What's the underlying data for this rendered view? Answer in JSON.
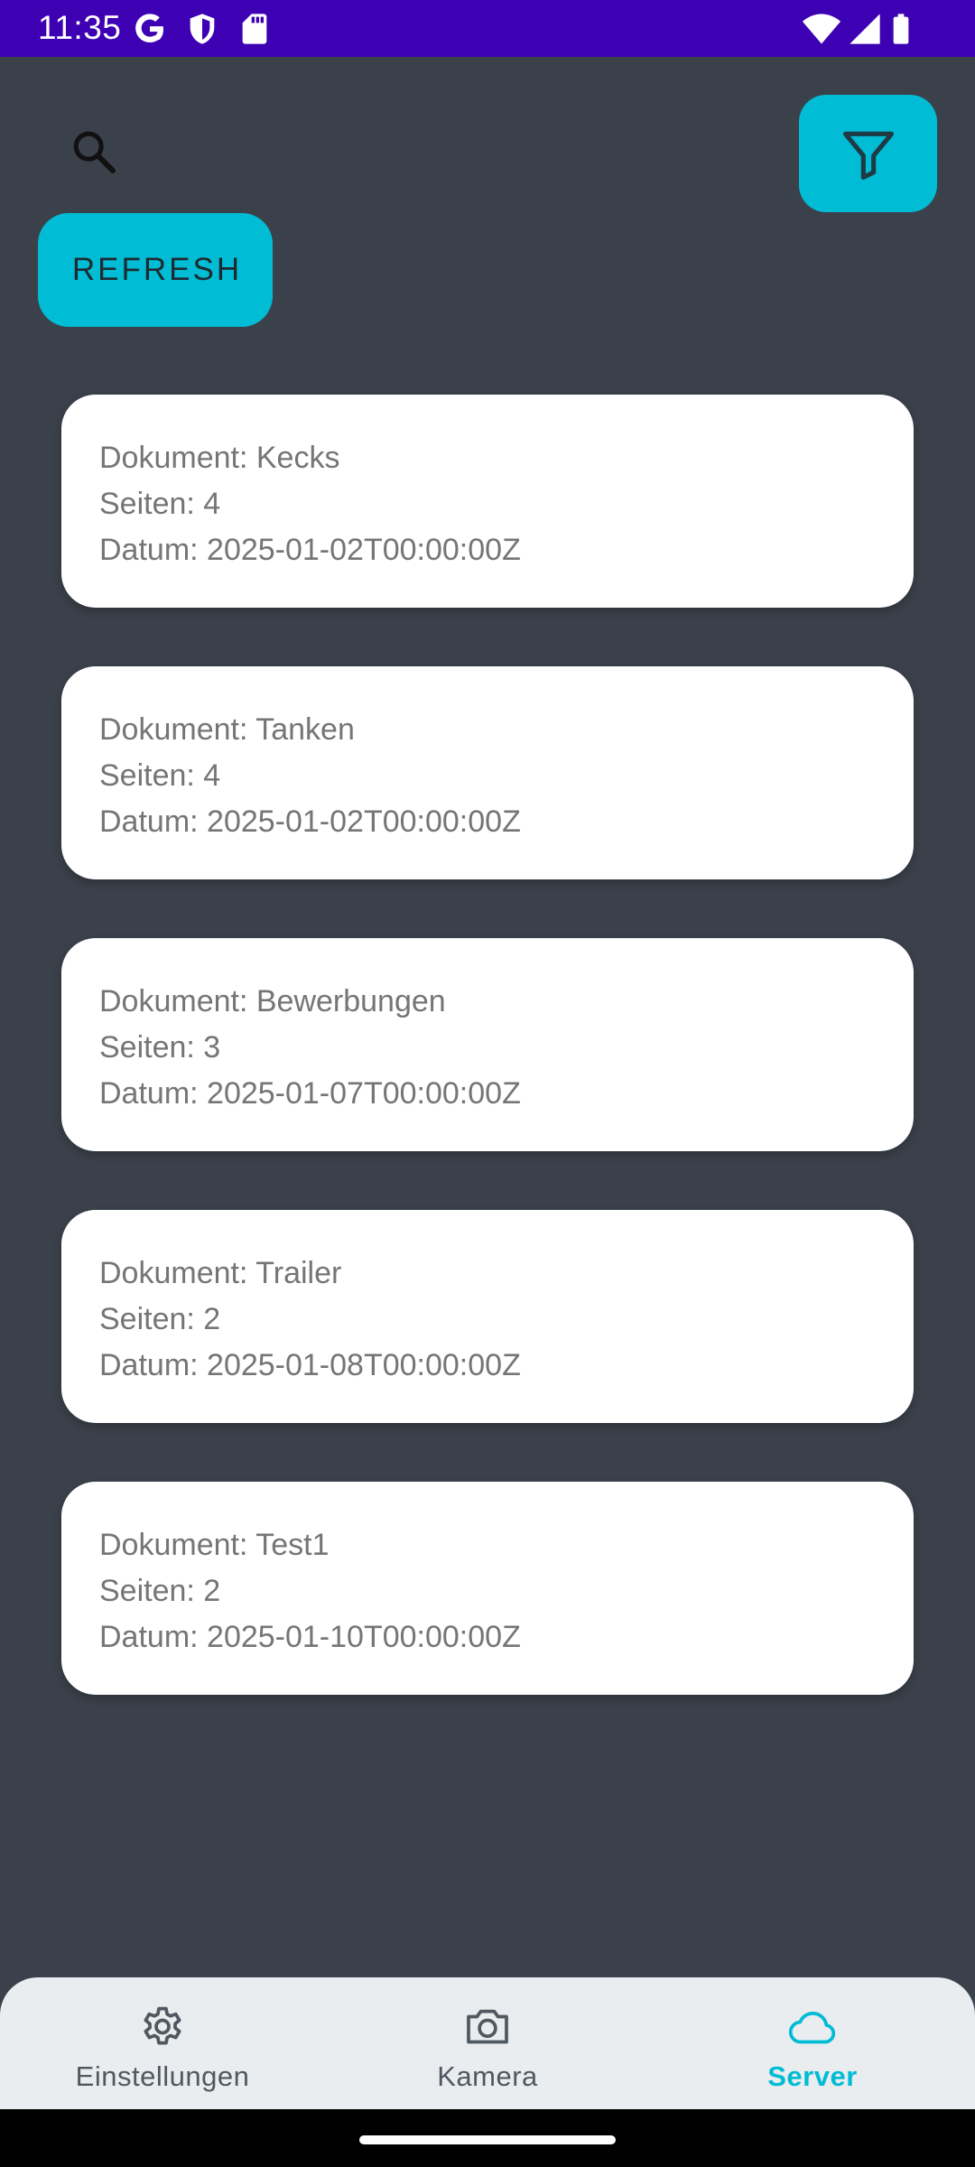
{
  "status_bar": {
    "time": "11:35"
  },
  "toolbar": {
    "refresh_label": "REFRESH"
  },
  "documents": [
    {
      "name": "Dokument: Kecks",
      "pages": "Seiten: 4",
      "date": "Datum: 2025-01-02T00:00:00Z"
    },
    {
      "name": "Dokument: Tanken",
      "pages": "Seiten: 4",
      "date": "Datum: 2025-01-02T00:00:00Z"
    },
    {
      "name": "Dokument: Bewerbungen",
      "pages": "Seiten: 3",
      "date": "Datum: 2025-01-07T00:00:00Z"
    },
    {
      "name": "Dokument: Trailer",
      "pages": "Seiten: 2",
      "date": "Datum: 2025-01-08T00:00:00Z"
    },
    {
      "name": "Dokument: Test1",
      "pages": "Seiten: 2",
      "date": "Datum: 2025-01-10T00:00:00Z"
    }
  ],
  "bottom_nav": {
    "items": [
      {
        "label": "Einstellungen",
        "icon": "gear-icon",
        "active": false
      },
      {
        "label": "Kamera",
        "icon": "camera-icon",
        "active": false
      },
      {
        "label": "Server",
        "icon": "cloud-icon",
        "active": true
      }
    ]
  },
  "colors": {
    "background": "#3b414b",
    "status_bar": "#3d00b3",
    "accent": "#00bcd4",
    "card": "#ffffff",
    "card_text": "#757575",
    "nav_background": "#eaedf0",
    "nav_inactive": "#505860"
  }
}
